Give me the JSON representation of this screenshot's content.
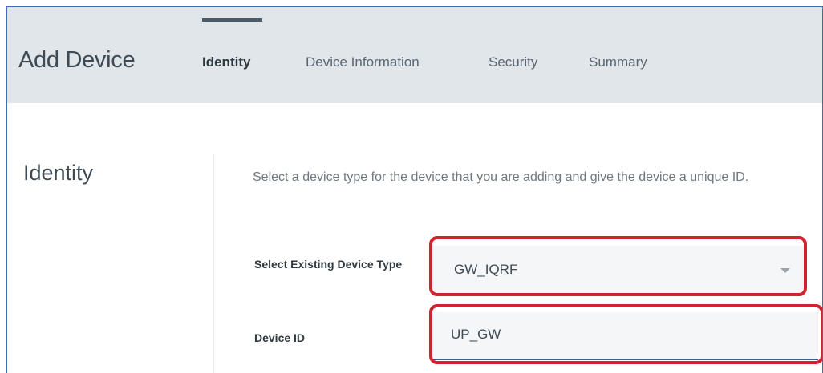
{
  "header": {
    "title": "Add Device",
    "tabs": [
      {
        "label": "Identity",
        "active": true
      },
      {
        "label": "Device Information",
        "active": false
      },
      {
        "label": "Security",
        "active": false
      },
      {
        "label": "Summary",
        "active": false
      }
    ]
  },
  "section": {
    "title": "Identity",
    "description": "Select a device type for the device that you are adding and give the device a unique ID."
  },
  "form": {
    "device_type": {
      "label": "Select Existing Device Type",
      "value": "GW_IQRF"
    },
    "device_id": {
      "label": "Device ID",
      "value": "UP_GW"
    }
  },
  "colors": {
    "header_bg": "#e0e6ea",
    "highlight": "#d0232f",
    "input_underline": "#3e5f8a"
  }
}
